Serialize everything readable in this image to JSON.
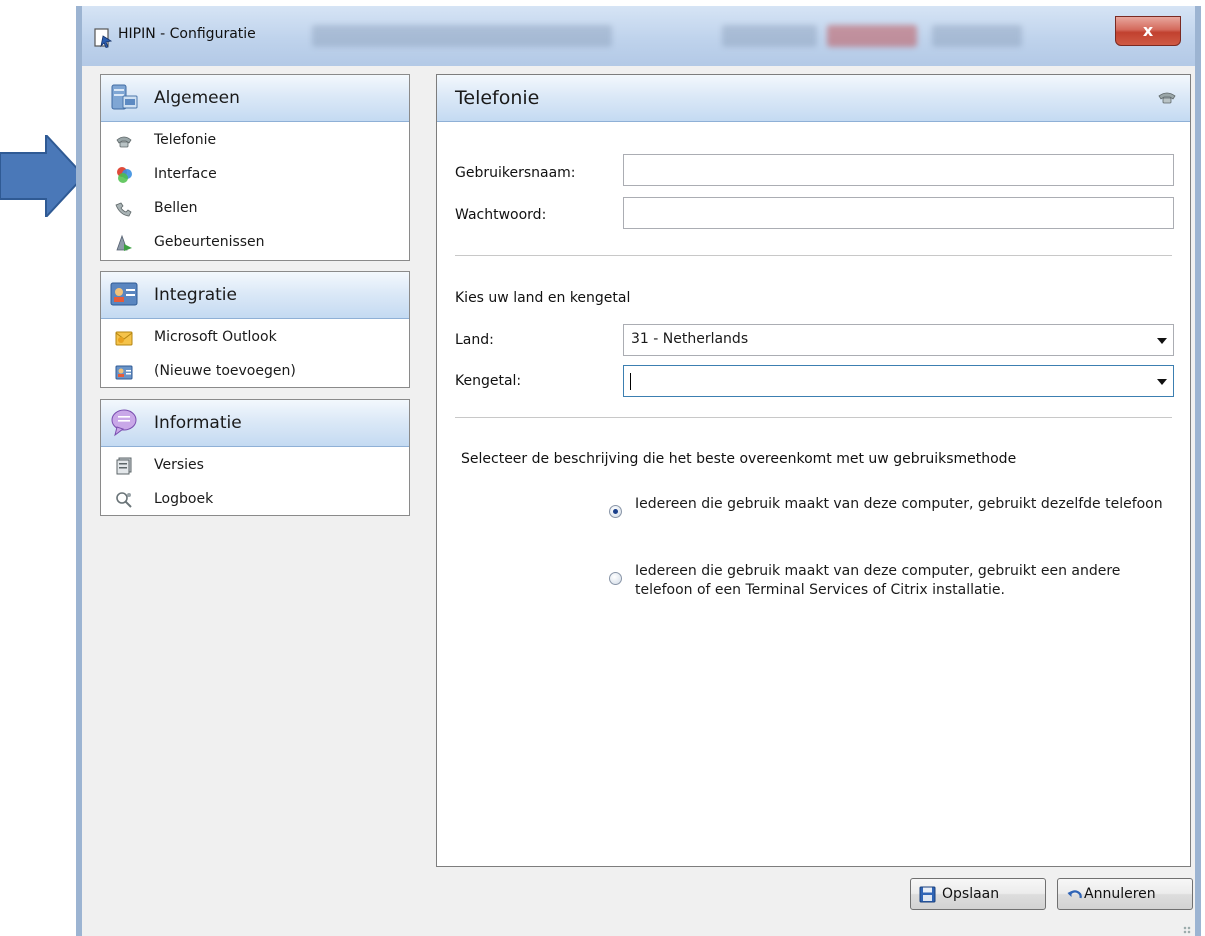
{
  "window": {
    "title": "HIPIN - Configuratie",
    "close_label": "x"
  },
  "sidebar": {
    "groups": [
      {
        "label": "Algemeen",
        "icon": "server-settings-icon",
        "items": [
          {
            "label": "Telefonie",
            "icon": "phone-icon"
          },
          {
            "label": "Interface",
            "icon": "color-circles-icon"
          },
          {
            "label": "Bellen",
            "icon": "phone-handset-icon"
          },
          {
            "label": "Gebeurtenissen",
            "icon": "events-icon"
          }
        ]
      },
      {
        "label": "Integratie",
        "icon": "contact-card-icon",
        "items": [
          {
            "label": "Microsoft Outlook",
            "icon": "outlook-icon"
          },
          {
            "label": "(Nieuwe toevoegen)",
            "icon": "contact-card-icon"
          }
        ]
      },
      {
        "label": "Informatie",
        "icon": "speech-bubble-icon",
        "items": [
          {
            "label": "Versies",
            "icon": "versions-icon"
          },
          {
            "label": "Logboek",
            "icon": "logbook-icon"
          }
        ]
      }
    ]
  },
  "panel": {
    "title": "Telefonie",
    "username": {
      "label": "Gebruikersnaam:",
      "value": ""
    },
    "password": {
      "label": "Wachtwoord:",
      "value": ""
    },
    "region_heading": "Kies uw land en kengetal",
    "country": {
      "label": "Land:",
      "value": "31 - Netherlands"
    },
    "area_code": {
      "label": "Kengetal:",
      "value": ""
    },
    "usage_heading": "Selecteer de beschrijving die het beste overeenkomt met uw gebruiksmethode",
    "usage_options": [
      {
        "label": "Iedereen die gebruik maakt van deze computer, gebruikt dezelfde telefoon",
        "checked": true
      },
      {
        "label": "Iedereen die gebruik maakt van deze computer, gebruikt een andere telefoon of een Terminal Services of Citrix installatie.",
        "checked": false
      }
    ]
  },
  "buttons": {
    "save_label": "Opslaan",
    "cancel_label": "Annuleren"
  },
  "colors": {
    "annotation_arrow": "#4a78b8",
    "header_gradient_end": "#c4daf2"
  }
}
